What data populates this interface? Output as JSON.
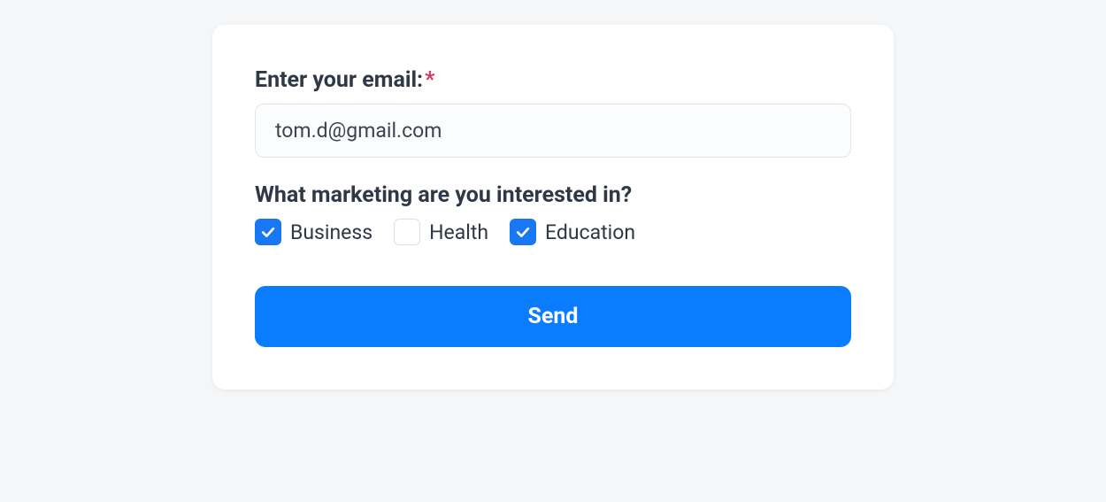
{
  "form": {
    "email": {
      "label": "Enter your email:",
      "required_marker": "*",
      "value": "tom.d@gmail.com"
    },
    "interests": {
      "label": "What marketing are you interested in?",
      "options": [
        {
          "label": "Business",
          "checked": true
        },
        {
          "label": "Health",
          "checked": false
        },
        {
          "label": "Education",
          "checked": true
        }
      ]
    },
    "submit_label": "Send"
  },
  "colors": {
    "accent": "#0a7cff",
    "required": "#d63864",
    "text": "#2e3846",
    "page_bg": "#f5f6f8"
  }
}
